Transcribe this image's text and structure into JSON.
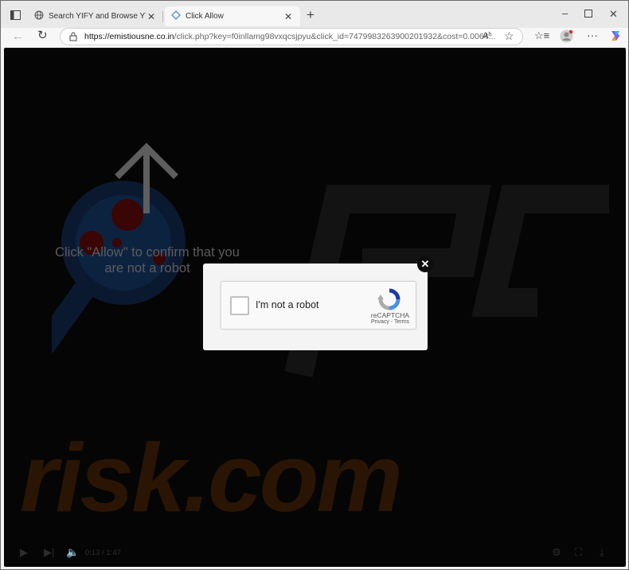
{
  "browser": {
    "tabs": [
      {
        "title": "Search YIFY and Browse YTS Movies"
      },
      {
        "title": "Click Allow"
      }
    ],
    "address": {
      "host": "https://emistiousne.co.in",
      "path": "/click.php?key=f0inllamg98vxqcsjpyu&click_id=7479983263900201932&cost=0.0064..."
    },
    "reader_label": "Aʰ"
  },
  "page": {
    "hint_line1": "Click \"Allow\" to confirm that you",
    "hint_line2": "are not a robot",
    "captcha": {
      "label": "I'm not a robot",
      "brand": "reCAPTCHA",
      "links": "Privacy - Terms"
    },
    "close_label": "✕",
    "watermark": "risk.com",
    "video_time": "0:13 / 1:47"
  },
  "colors": {
    "accent": "#4a90e2",
    "brand_orange": "#2a1505"
  }
}
